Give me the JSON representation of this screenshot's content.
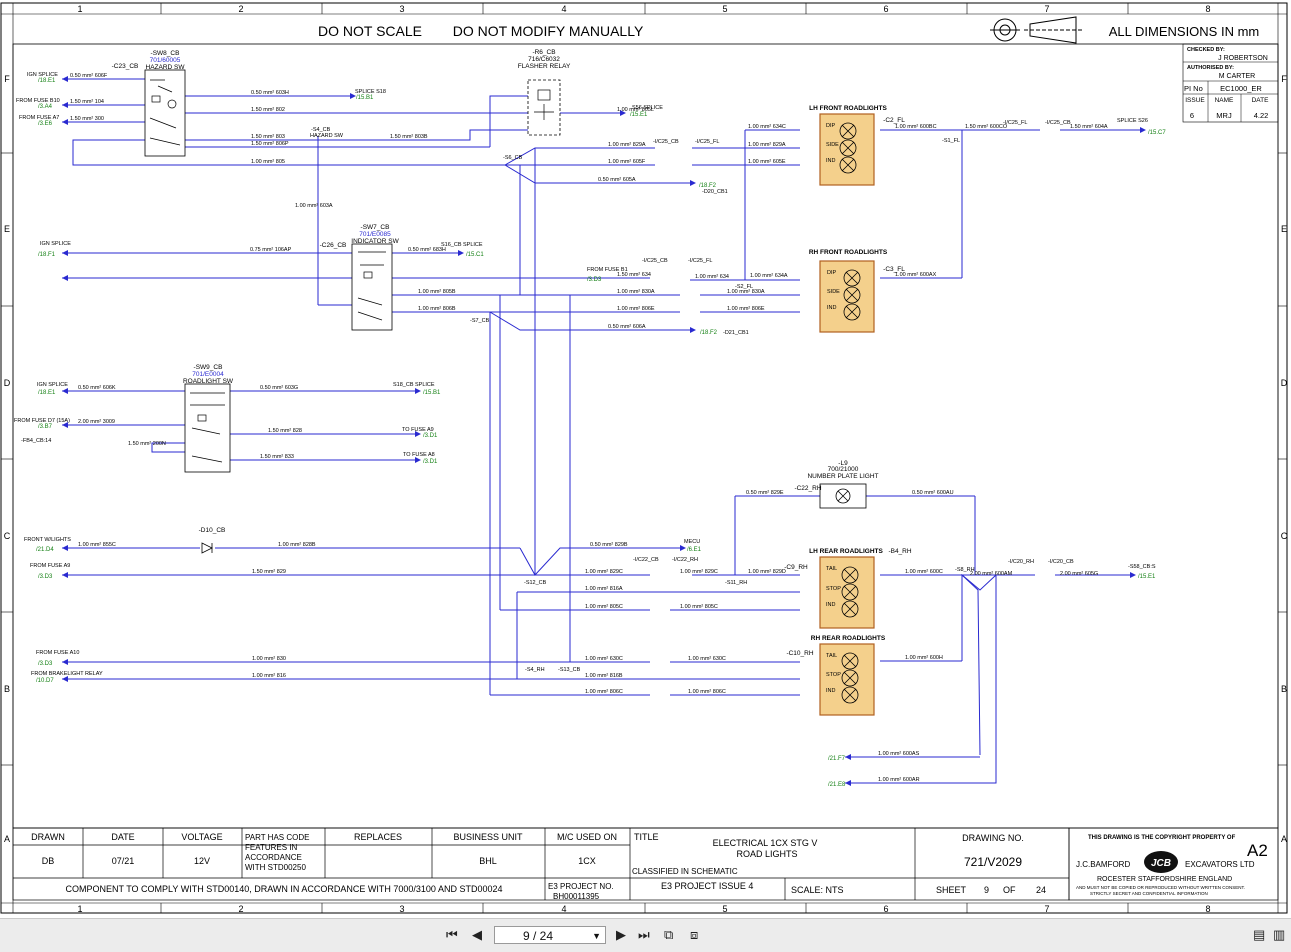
{
  "header": {
    "do_not_scale": "DO NOT SCALE",
    "do_not_modify": "DO NOT MODIFY MANUALLY",
    "dimensions": "ALL DIMENSIONS IN mm"
  },
  "grid": {
    "cols": [
      "1",
      "2",
      "3",
      "4",
      "5",
      "6",
      "7",
      "8"
    ],
    "rows": [
      "F",
      "E",
      "D",
      "C",
      "B",
      "A"
    ]
  },
  "approval": {
    "checked_by_label": "CHECKED BY:",
    "checked_by": "J ROBERTSON",
    "authorised_label": "AUTHORISED BY:",
    "authorised_by": "M CARTER",
    "pi_no_label": "PI No",
    "pi_no": "EC1000_ER",
    "issue_label": "ISSUE",
    "name_label": "NAME",
    "date_label": "DATE",
    "issue": "6",
    "name": "MRJ",
    "date": "4.22"
  },
  "components": {
    "sw8_ref": "-SW8_CB",
    "sw8_part": "701/60005",
    "sw8_name": "HAZARD SW",
    "c23": "-C23_CB",
    "r6_ref": "-R6_CB",
    "r6_part": "716/C6032",
    "r6_name": "FLASHER RELAY",
    "sw7_ref": "-SW7_CB",
    "sw7_part": "701/E0085",
    "sw7_name": "INDICATOR SW",
    "sw9_ref": "-SW9_CB",
    "sw9_part": "701/E0004",
    "sw9_name": "ROADLIGHT SW",
    "d10": "-D10_CB",
    "l9_ref": "-L9",
    "l9_part": "700/21000",
    "l9_name": "NUMBER PLATE LIGHT",
    "lh_front": "LH FRONT ROADLIGHTS",
    "rh_front": "RH FRONT ROADLIGHTS",
    "lh_rear": "LH REAR ROADLIGHTS",
    "rh_rear": "RH REAR ROADLIGHTS",
    "b4_rh": "-B4_RH",
    "c2_fl": "-C2_FL",
    "c3_fl": "-C3_FL",
    "c9_rh": "-C9_RH",
    "c10_rh": "-C10_RH",
    "c22_rh": "-C22_RH",
    "c26": "-C26_CB",
    "dip": "DIP",
    "side": "SIDE",
    "ind": "IND",
    "tail": "TAIL",
    "stop": "STOP"
  },
  "labels": {
    "ign_splice": "IGN SPLICE",
    "ign_ref": "/18.E1",
    "fuse_b10": "FROM FUSE B10",
    "fuse_b10_ref": "/3.A4",
    "fuse_a7": "FROM FUSE A7",
    "fuse_a7_ref": "/3.E6",
    "splice_s18": "SPLICE S18",
    "splice_s18_ref": "/15.B1",
    "s56": "S56 SPLICE",
    "s56_ref": "/15.E1",
    "splice_s26": "SPLICE S26",
    "splice_s26_ref": "/15.C7",
    "ref_18f2": "/18.F2",
    "d20": "-D20_CB1",
    "d21": "-D21_CB1",
    "s4_hazard": "-S4_CB",
    "s4_hazard_b": "HAZARD SW",
    "s6": "-S6_CB",
    "s7": "-S7_CB",
    "s12": "-S12_CB",
    "s13": "-S13_CB",
    "s4_rh": "-S4_RH",
    "s11_rh": "-S11_RH",
    "s8_rh": "-S8_RH",
    "s1_fl": "-S1_FL",
    "s2_fl": "-S2_FL",
    "ign_splice_e": "IGN SPLICE",
    "ign_splice_e_ref": "/18.F1",
    "s16": "S16_CB SPLICE",
    "s16_ref": "/15.C1",
    "fuse_b1": "FROM FUSE B1",
    "fuse_b1_ref": "/3.D3",
    "ign_splice_d": "IGN SPLICE",
    "ign_splice_d_ref": "/18.E1",
    "s18b": "S18_CB SPLICE",
    "s18b_ref": "/15.B1",
    "fuse_d7": "FROM FUSE D7 (15A)",
    "fuse_d7_ref": "/3.B7",
    "fb4": "-FB4_CB:14",
    "to_a9": "TO FUSE A9",
    "to_a9_ref": "/3.D1",
    "to_a8": "TO FUSE A8",
    "to_a8_ref": "/3.D1",
    "front_wl": "FRONT W/LIGHTS",
    "front_wl_ref": "/21.D4",
    "fuse_a9": "FROM FUSE A9",
    "fuse_a9_ref": "/3.D3",
    "mecu": "MECU",
    "mecu_ref": "/6.E1",
    "s58": "-S58_CB:S",
    "s58_ref": "/15.E1",
    "fuse_a10": "FROM FUSE A10",
    "fuse_a10_ref": "/3.D3",
    "brake_relay": "FROM BRAKELIGHT RELAY",
    "brake_relay_ref": "/10.D7",
    "ref_21f7": "/21.F7",
    "ref_21e8": "/21.E8",
    "uc25_cb": "-I/C25_CB",
    "uc25_fl": "-I/C25_FL",
    "uc22_cb": "-I/C22_CB",
    "uc22_rh": "-I/C22_RH",
    "uc20_rh": "-I/C20_RH",
    "uc20_cb": "-I/C20_CB"
  },
  "wires": {
    "w606f": "0.50 mm² 606F",
    "w104": "1.50 mm² 104",
    "w300": "1.50 mm² 300",
    "w603h": "0.50 mm² 603H",
    "w802": "1.50 mm² 802",
    "w803": "1.50 mm² 803",
    "w806p": "1.50 mm² 806P",
    "w803b": "1.50 mm² 803B",
    "w805": "1.00 mm² 805",
    "w805l": "1.00 mm² 805L",
    "w634c": "1.00 mm² 634C",
    "w829a": "1.00 mm² 829A",
    "w605f": "1.00 mm² 605F",
    "w605e": "1.00 mm² 605E",
    "w605a": "0.50 mm² 605A",
    "w603a": "1.00 mm² 603A",
    "w600bc": "1.00 mm² 600BC",
    "w600co": "1.50 mm² 600CO",
    "w604a": "1.50 mm² 604A",
    "w106ap": "0.75 mm² 106AP",
    "w683h": "0.50 mm² 683H",
    "w634": "1.50 mm² 634",
    "w634b": "1.00 mm² 634",
    "w634a": "1.00 mm² 634A",
    "w600ax": "1.00 mm² 600AX",
    "w805b": "1.00 mm² 805B",
    "w806b": "1.00 mm² 806B",
    "w830a": "1.00 mm² 830A",
    "w806e": "1.00 mm² 806E",
    "w606a": "0.50 mm² 606A",
    "w606k": "0.50 mm² 606K",
    "w603g": "0.50 mm² 603G",
    "w3009": "2.00 mm² 3009",
    "w200n": "1.50 mm² 200N",
    "w828": "1.50 mm² 828",
    "w833": "1.50 mm² 833",
    "w829e": "0.50 mm² 829E",
    "w600au": "0.50 mm² 600AU",
    "w855c": "1.00 mm² 855C",
    "w828b": "1.00 mm² 828B",
    "w829b": "0.50 mm² 829B",
    "w829": "1.50 mm² 829",
    "w829c": "1.00 mm² 829C",
    "w829d": "1.00 mm² 829D",
    "w600c": "1.00 mm² 600C",
    "w600am": "2.00 mm² 600AM",
    "w605g": "2.00 mm² 605G",
    "w816a": "1.00 mm² 816A",
    "w805c": "1.00 mm² 805C",
    "w830": "1.00 mm² 830",
    "w816": "1.00 mm² 816",
    "w630c": "1.00 mm² 630C",
    "w816b": "1.00 mm² 816B",
    "w806c": "1.00 mm² 806C",
    "w600h": "1.00 mm² 600H",
    "w600as": "1.00 mm² 600AS",
    "w600ar": "1.00 mm² 600AR"
  },
  "title_block": {
    "drawn_label": "DRAWN",
    "drawn": "DB",
    "date_label": "DATE",
    "date": "07/21",
    "voltage_label": "VOLTAGE",
    "voltage": "12V",
    "part_code_1": "PART HAS CODE",
    "part_code_2": "FEATURES IN",
    "part_code_3": "ACCORDANCE",
    "part_code_4": "WITH STD00250",
    "replaces_label": "REPLACES",
    "bu_label": "BUSINESS UNIT",
    "bu": "BHL",
    "mc_label": "M/C USED ON",
    "mc": "1CX",
    "title_label": "TITLE",
    "title_1": "ELECTRICAL 1CX STG V",
    "title_2": "ROAD LIGHTS",
    "classified": "CLASSIFIED IN   SCHEMATIC",
    "drawing_no_label": "DRAWING NO.",
    "drawing_no": "721/V2029",
    "comply": "COMPONENT TO COMPLY WITH STD00140, DRAWN IN ACCORDANCE WITH 7000/3100 AND STD00024",
    "e3_label": "E3 PROJECT NO.",
    "e3": "BH00011395",
    "e3_issue": "E3 PROJECT ISSUE  4",
    "scale": "SCALE:    NTS",
    "sheet_label": "SHEET",
    "sheet_no": "9",
    "of_label": "OF",
    "sheet_total": "24",
    "copyright": "THIS DRAWING IS THE COPYRIGHT PROPERTY OF",
    "size": "A2",
    "company_1": "J.C.BAMFORD",
    "company_2": "EXCAVATORS LTD",
    "logo": "JCB",
    "address": "ROCESTER    STAFFORDSHIRE    ENGLAND",
    "legal_1": "AND MUST NOT BE COPIED OR REPRODUCED WITHOUT WRITTEN CONSENT.",
    "legal_2": "STRICTLY SECRET AND CONFIDENTIAL INFORMATION"
  },
  "viewer": {
    "page_value": "9 / 24"
  },
  "colors": {
    "wire": "#2a2ad0",
    "ref": "#148014",
    "lamp_fill": "#f4d08c",
    "lamp_border": "#b06020"
  }
}
